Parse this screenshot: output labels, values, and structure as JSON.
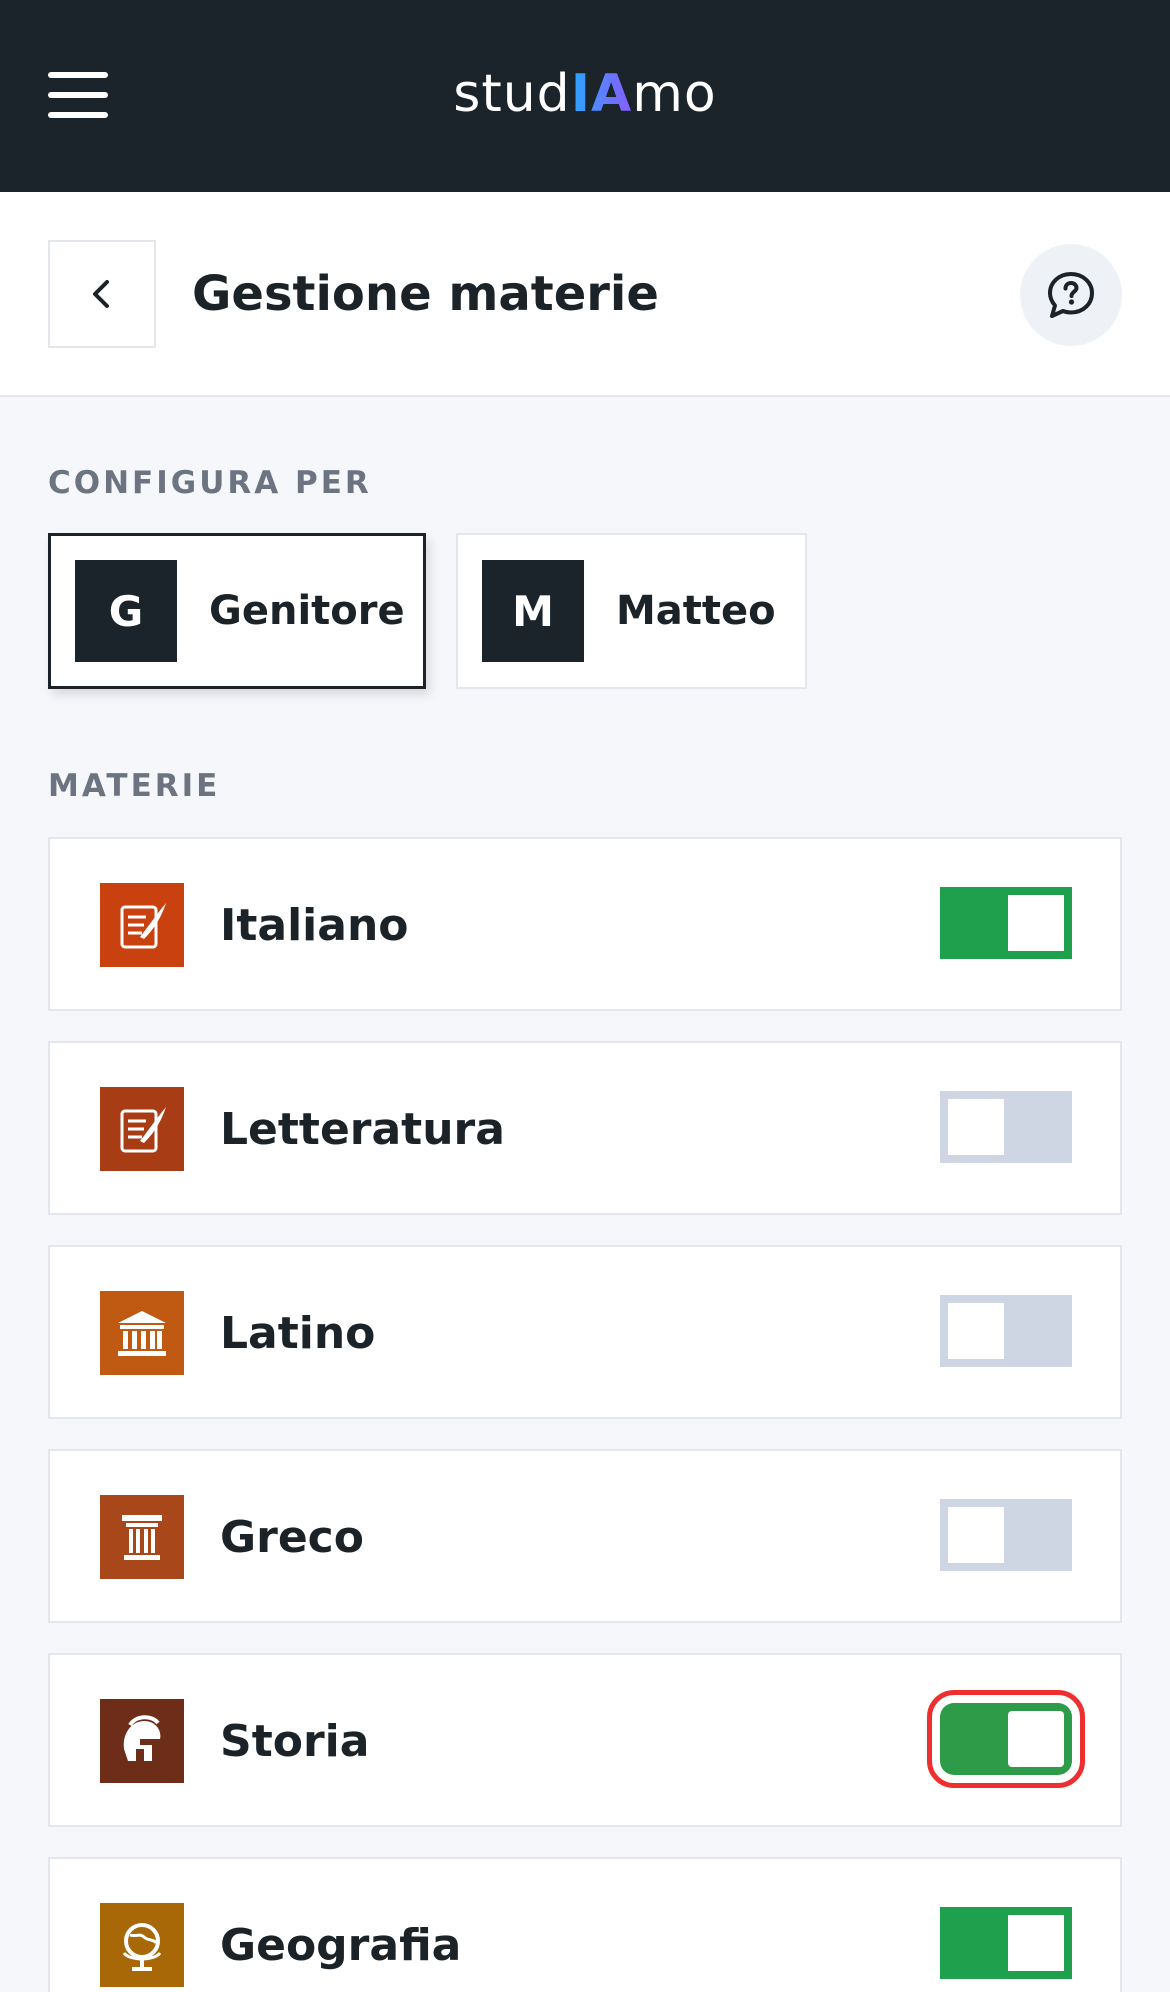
{
  "app": {
    "logo_prefix": "stud",
    "logo_mid": "IA",
    "logo_suffix": "mo"
  },
  "header": {
    "title": "Gestione materie"
  },
  "configure": {
    "label": "CONFIGURA PER",
    "profiles": [
      {
        "initial": "G",
        "name": "Genitore",
        "selected": true
      },
      {
        "initial": "M",
        "name": "Matteo",
        "selected": false
      }
    ]
  },
  "subjects": {
    "label": "MATERIE",
    "items": [
      {
        "name": "Italiano",
        "icon": "quill-scroll-icon",
        "color": "#c8410f",
        "enabled": true
      },
      {
        "name": "Letteratura",
        "icon": "quill-scroll-icon",
        "color": "#a83c14",
        "enabled": false
      },
      {
        "name": "Latino",
        "icon": "temple-icon",
        "color": "#c05a12",
        "enabled": false
      },
      {
        "name": "Greco",
        "icon": "column-icon",
        "color": "#a8481a",
        "enabled": false
      },
      {
        "name": "Storia",
        "icon": "helmet-icon",
        "color": "#6e2d18",
        "enabled": true
      },
      {
        "name": "Geografia",
        "icon": "globe-icon",
        "color": "#a86808",
        "enabled": true
      }
    ]
  },
  "colors": {
    "topbar": "#1b232b",
    "toggle_on": "#1fa04d",
    "toggle_off": "#cdd6e2",
    "focus_ring": "#ee2f2f"
  }
}
